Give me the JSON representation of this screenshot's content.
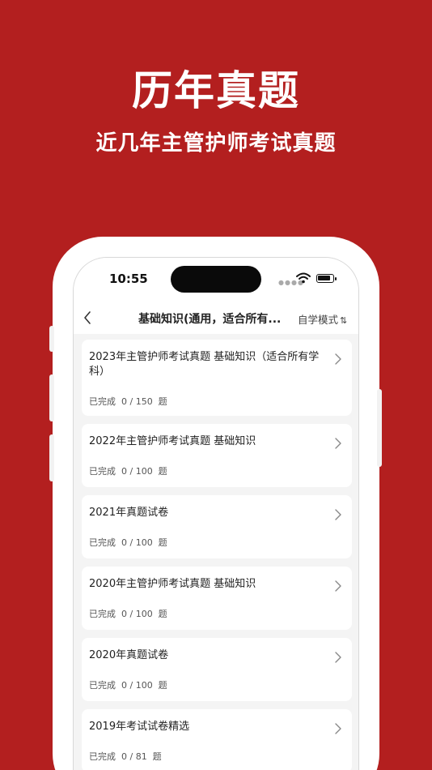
{
  "hero": {
    "title": "历年真题",
    "subtitle": "近几年主管护师考试真题"
  },
  "status_bar": {
    "time": "10:55"
  },
  "nav": {
    "title": "基础知识(通用，适合所有...",
    "mode_label": "自学模式",
    "mode_icon": "sort-icon",
    "mode_icon_glyph": "⇅"
  },
  "papers": [
    {
      "title": "2023年主管护师考试真题 基础知识（适合所有学科）",
      "progress": "已完成  0 / 150  题"
    },
    {
      "title": "2022年主管护师考试真题 基础知识",
      "progress": "已完成  0 / 100  题"
    },
    {
      "title": "2021年真题试卷",
      "progress": "已完成  0 / 100  题"
    },
    {
      "title": "2020年主管护师考试真题 基础知识",
      "progress": "已完成  0 / 100  题"
    },
    {
      "title": "2020年真题试卷",
      "progress": "已完成  0 / 100  题"
    },
    {
      "title": "2019年考试试卷精选",
      "progress": "已完成  0 / 81  题"
    }
  ],
  "colors": {
    "background": "#b31f1f",
    "card": "#ffffff",
    "screen": "#f4f4f4"
  }
}
